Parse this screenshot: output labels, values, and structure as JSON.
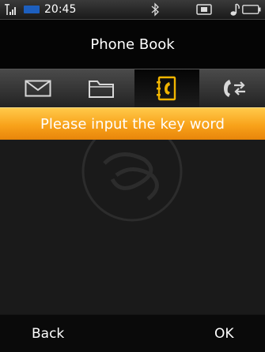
{
  "status": {
    "time": "20:45",
    "icons": [
      "signal-icon",
      "network-icon",
      "bluetooth-icon",
      "sim-icon",
      "music-icon",
      "battery-icon"
    ]
  },
  "header": {
    "title": "Phone Book"
  },
  "tabs": [
    {
      "icon": "envelope-icon",
      "selected": false
    },
    {
      "icon": "folder-icon",
      "selected": false
    },
    {
      "icon": "phonebook-icon",
      "selected": true
    },
    {
      "icon": "call-transfer-icon",
      "selected": false
    }
  ],
  "search": {
    "placeholder": "Please input the key word"
  },
  "softkeys": {
    "left": "Back",
    "right": "OK"
  },
  "colors": {
    "accent": "#f8a21a",
    "selected_tab_icon": "#f0b400",
    "background": "#1a1a1a"
  }
}
